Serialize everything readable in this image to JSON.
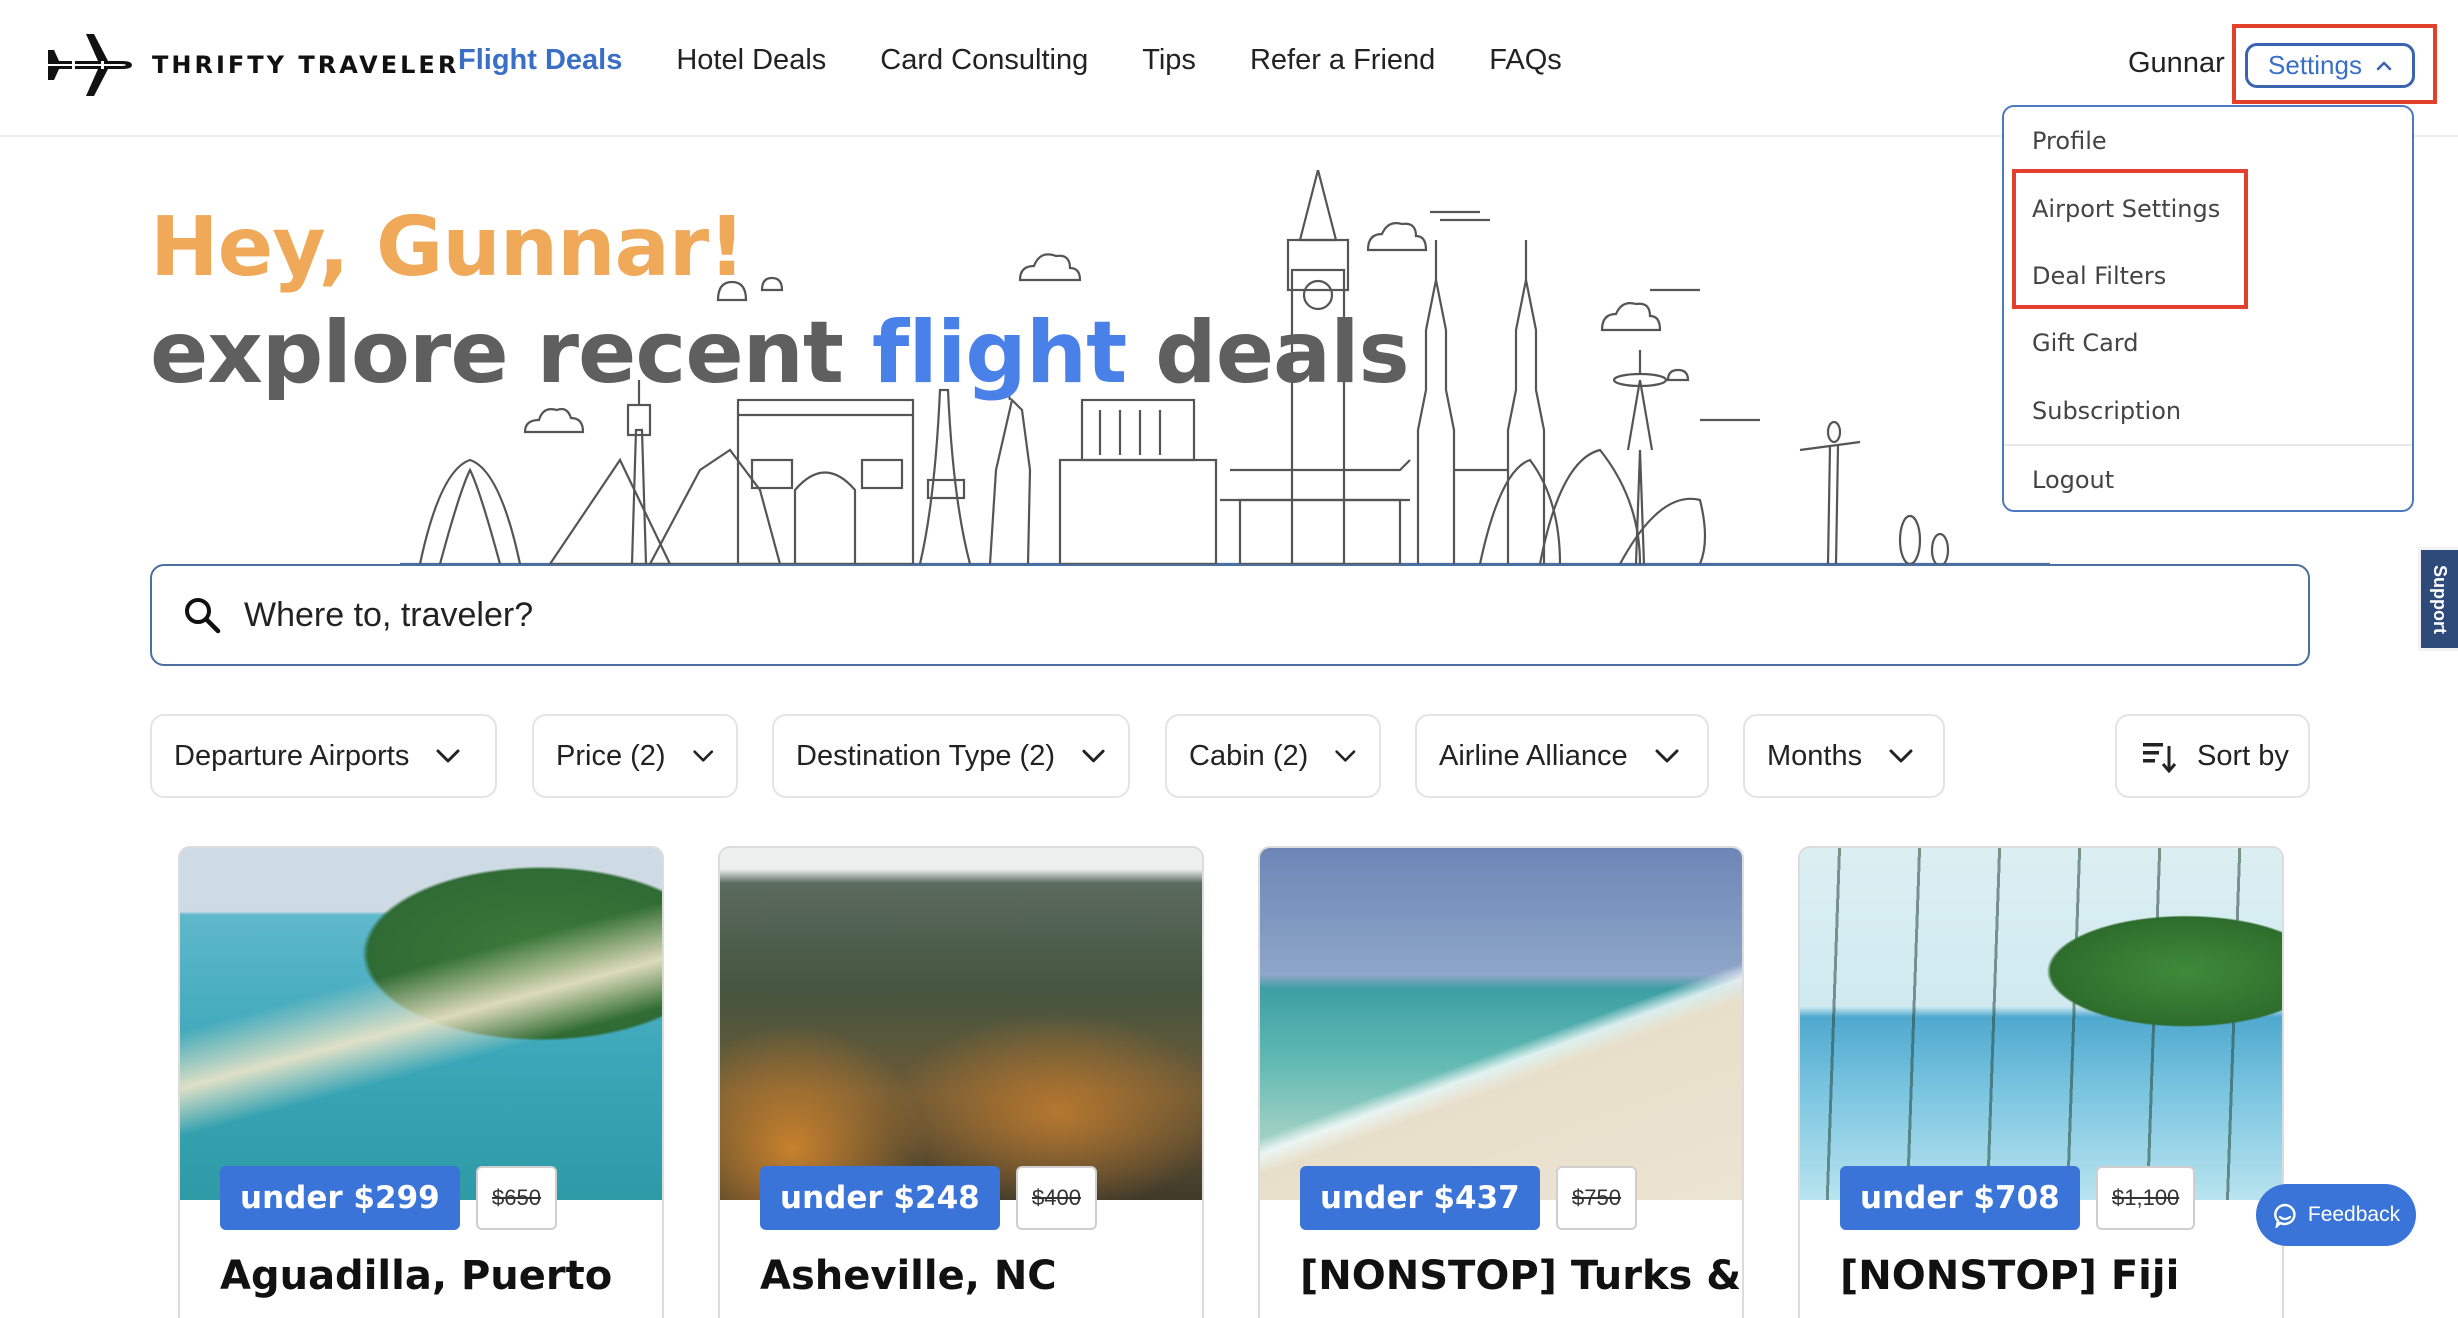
{
  "header": {
    "logo_text": "THRIFTY TRAVELER",
    "nav": [
      {
        "label": "Flight Deals",
        "active": true
      },
      {
        "label": "Hotel Deals",
        "active": false
      },
      {
        "label": "Card Consulting",
        "active": false
      },
      {
        "label": "Tips",
        "active": false
      },
      {
        "label": "Refer a Friend",
        "active": false
      },
      {
        "label": "FAQs",
        "active": false
      }
    ],
    "user_name": "Gunnar",
    "settings_label": "Settings"
  },
  "settings_menu": {
    "items": [
      {
        "label": "Profile"
      },
      {
        "label": "Airport Settings"
      },
      {
        "label": "Deal Filters"
      },
      {
        "label": "Gift Card"
      },
      {
        "label": "Subscription"
      },
      {
        "label": "Logout"
      }
    ]
  },
  "hero": {
    "greeting": "Hey, Gunnar!",
    "title_prefix": "explore recent ",
    "title_accent": "flight",
    "title_suffix": " deals"
  },
  "search": {
    "placeholder": "Where to, traveler?",
    "value": ""
  },
  "filters": [
    {
      "label": "Departure Airports"
    },
    {
      "label": "Price (2)"
    },
    {
      "label": "Destination Type (2)"
    },
    {
      "label": "Cabin (2)"
    },
    {
      "label": "Airline Alliance"
    },
    {
      "label": "Months"
    }
  ],
  "sort": {
    "label": "Sort by"
  },
  "deals": [
    {
      "price": "under $299",
      "original": "$650",
      "title": "Aguadilla, Puerto"
    },
    {
      "price": "under $248",
      "original": "$400",
      "title": "Asheville, NC"
    },
    {
      "price": "under $437",
      "original": "$750",
      "title": "[NONSTOP] Turks &"
    },
    {
      "price": "under $708",
      "original": "$1,100",
      "title": "[NONSTOP] Fiji"
    }
  ],
  "widgets": {
    "support_label": "Support",
    "feedback_label": "Feedback"
  },
  "colors": {
    "accent_blue": "#3b74d8",
    "nav_active": "#3a6fc6",
    "greeting_orange": "#f0a859",
    "headline_gray": "#5f5f5f",
    "headline_accent": "#4a81e8",
    "annotation_red": "#e2422b",
    "support_navy": "#2e4a7a"
  }
}
